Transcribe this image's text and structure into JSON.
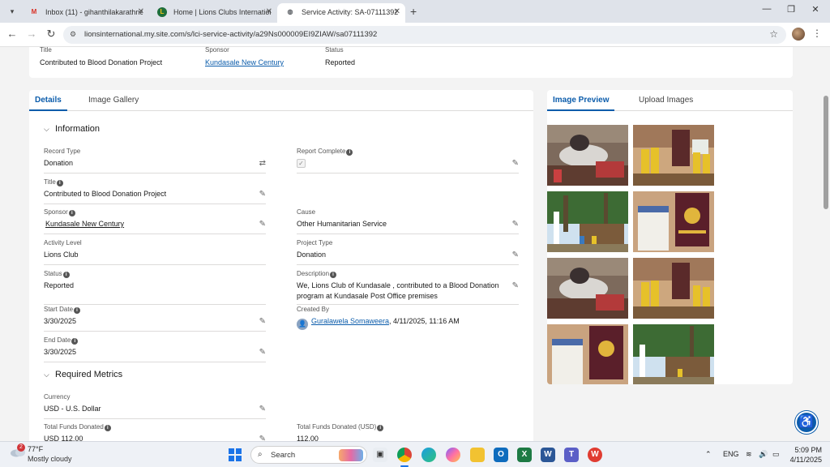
{
  "browser": {
    "tabs": [
      {
        "title": "Inbox (11) - gihanthilakarathne",
        "icon": "gmail-icon",
        "color": "#d93025",
        "active": false
      },
      {
        "title": "Home | Lions Clubs Internation",
        "icon": "lions-icon",
        "color": "#1f6f3a",
        "active": false
      },
      {
        "title": "Service Activity: SA-07111392",
        "icon": "globe-icon",
        "color": "#5f6368",
        "active": true
      }
    ],
    "url": "lionsinternational.my.site.com/s/lci-service-activity/a29Ns000009EI9ZIAW/sa07111392"
  },
  "header": {
    "title_label": "Title",
    "title_value": "Contributed to Blood Donation Project",
    "sponsor_label": "Sponsor",
    "sponsor_value": "Kundasale New Century",
    "status_label": "Status",
    "status_value": "Reported"
  },
  "main_tabs": [
    "Details",
    "Image Gallery"
  ],
  "sections": {
    "information": "Information",
    "required_metrics": "Required Metrics"
  },
  "fields": {
    "record_type": {
      "label": "Record Type",
      "value": "Donation"
    },
    "report_complete": {
      "label": "Report Complete"
    },
    "title": {
      "label": "Title",
      "value": "Contributed to Blood Donation Project"
    },
    "sponsor": {
      "label": "Sponsor",
      "value": "Kundasale New Century"
    },
    "cause": {
      "label": "Cause",
      "value": "Other Humanitarian Service"
    },
    "activity_level": {
      "label": "Activity Level",
      "value": "Lions Club"
    },
    "project_type": {
      "label": "Project Type",
      "value": "Donation"
    },
    "status": {
      "label": "Status",
      "value": "Reported"
    },
    "description": {
      "label": "Description",
      "value": "We, Lions Club of Kundasale , contributed to a Blood Donation program at Kundasale Post Office premises"
    },
    "start_date": {
      "label": "Start Date",
      "value": "3/30/2025"
    },
    "created_by": {
      "label": "Created By",
      "user": "Guralawela Somaweera",
      "timestamp": ", 4/11/2025, 11:16 AM"
    },
    "end_date": {
      "label": "End Date",
      "value": "3/30/2025"
    },
    "currency": {
      "label": "Currency",
      "value": "USD - U.S. Dollar"
    },
    "total_funds": {
      "label": "Total Funds Donated",
      "value": "USD 112.00"
    },
    "total_funds_usd": {
      "label": "Total Funds Donated (USD)",
      "value": "112.00"
    }
  },
  "side_tabs": [
    "Image Preview",
    "Upload Images"
  ],
  "taskbar": {
    "notification_count": "2",
    "temperature": "77°F",
    "weather": "Mostly cloudy",
    "search_placeholder": "Search",
    "language": "ENG",
    "time": "5:09 PM",
    "date": "4/11/2025"
  },
  "colors": {
    "accent": "#0b5cab",
    "link": "#0b5cab"
  }
}
